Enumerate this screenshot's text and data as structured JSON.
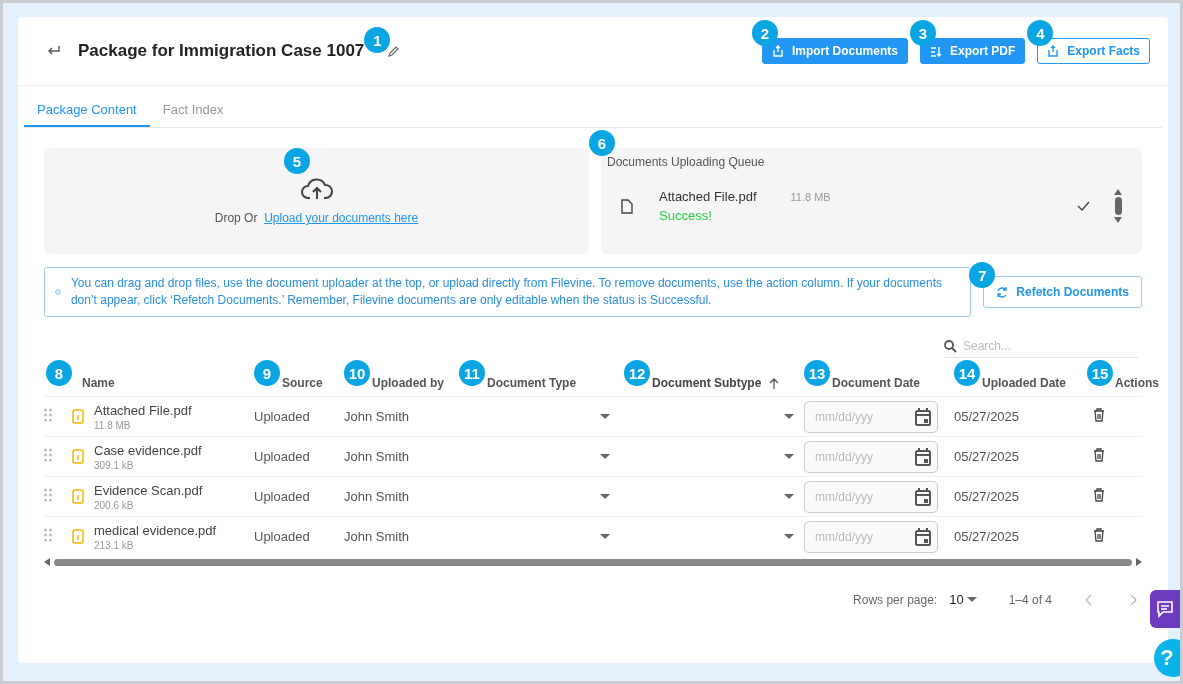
{
  "header": {
    "title": "Package for Immigration Case 1007",
    "callout": "1",
    "buttons": [
      {
        "label": "Import Documents",
        "kind": "filled",
        "callout": "2"
      },
      {
        "label": "Export PDF",
        "kind": "filled",
        "callout": "3"
      },
      {
        "label": "Export Facts",
        "kind": "outlined",
        "callout": "4"
      }
    ]
  },
  "tabs": [
    {
      "label": "Package Content",
      "selected": true
    },
    {
      "label": "Fact Index",
      "selected": false
    }
  ],
  "dropzone": {
    "callout": "5",
    "prefix": "Drop Or",
    "link": "Upload your documents here"
  },
  "queue": {
    "callout": "6",
    "title": "Documents Uploading Queue",
    "items": [
      {
        "name": "Attached File.pdf",
        "size": "11.8 MB",
        "status": "Success!",
        "done": true
      }
    ]
  },
  "info": {
    "text": "You can drag and drop files, use the document uploader at the top, or upload directly from Filevine. To remove documents, use the action column. If your documents don’t appear, click ‘Refetch Documents.’ Remember, Filevine documents are only editable when the status is Successful.",
    "refetch": {
      "label": "Refetch Documents",
      "callout": "7"
    }
  },
  "search": {
    "placeholder": "Search..."
  },
  "table": {
    "columns": [
      {
        "label": "Name",
        "callout": "8",
        "sorted": false
      },
      {
        "label": "Source",
        "callout": "9",
        "sorted": false
      },
      {
        "label": "Uploaded by",
        "callout": "10",
        "sorted": false
      },
      {
        "label": "Document Type",
        "callout": "11",
        "sorted": false
      },
      {
        "label": "Document Subtype",
        "callout": "12",
        "sorted": true
      },
      {
        "label": "Document Date",
        "callout": "13",
        "sorted": false
      },
      {
        "label": "Uploaded Date",
        "callout": "14",
        "sorted": false
      },
      {
        "label": "Actions",
        "callout": "15",
        "sorted": false
      }
    ],
    "rows": [
      {
        "name": "Attached File.pdf",
        "size": "11.8 MB",
        "source": "Uploaded",
        "uploaded_by": "John Smith",
        "date_placeholder": "mm/dd/yyy",
        "uploaded_date": "05/27/2025"
      },
      {
        "name": "Case evidence.pdf",
        "size": "309.1 kB",
        "source": "Uploaded",
        "uploaded_by": "John Smith",
        "date_placeholder": "mm/dd/yyy",
        "uploaded_date": "05/27/2025"
      },
      {
        "name": "Evidence Scan.pdf",
        "size": "200.6 kB",
        "source": "Uploaded",
        "uploaded_by": "John Smith",
        "date_placeholder": "mm/dd/yyy",
        "uploaded_date": "05/27/2025"
      },
      {
        "name": "medical evidence.pdf",
        "size": "213.1 kB",
        "source": "Uploaded",
        "uploaded_by": "John Smith",
        "date_placeholder": "mm/dd/yyy",
        "uploaded_date": "05/27/2025"
      }
    ]
  },
  "pagination": {
    "rows_label": "Rows per page:",
    "rows_value": "10",
    "range": "1–4 of 4"
  },
  "help_button": {
    "label": "?"
  }
}
